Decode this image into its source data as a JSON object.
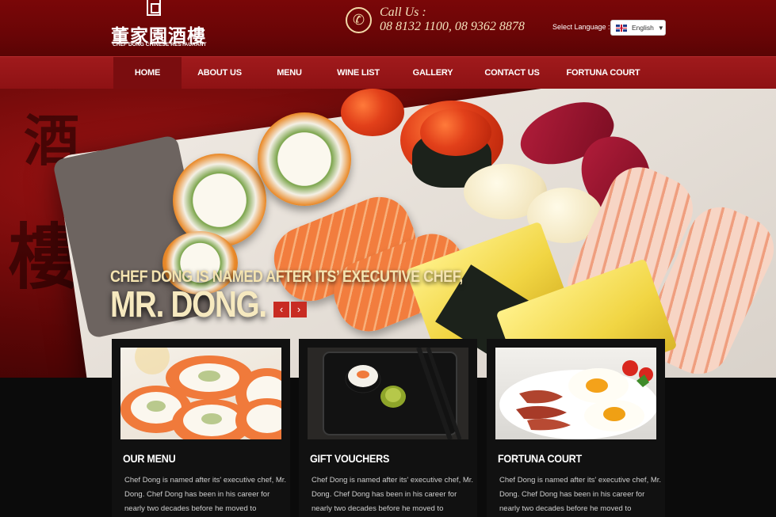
{
  "header": {
    "logo_chinese": "董家園酒樓",
    "logo_english": "CHEF DONG CHINESE RESTAURANT",
    "call_label": "Call Us :",
    "phone_numbers": "08 8132 1100, 08 9362 8878",
    "language_label": "Select Language :",
    "language_selected": "English"
  },
  "nav": {
    "items": [
      {
        "label": "HOME",
        "active": true
      },
      {
        "label": "ABOUT US"
      },
      {
        "label": "MENU"
      },
      {
        "label": "WINE LIST"
      },
      {
        "label": "GALLERY"
      },
      {
        "label": "CONTACT US"
      },
      {
        "label": "FORTUNA COURT"
      }
    ]
  },
  "hero": {
    "line1": "CHEF DONG IS NAMED AFTER ITS’ EXECUTIVE CHEF,",
    "line2": "MR. DONG.",
    "prev_label": "‹",
    "next_label": "›"
  },
  "cards": [
    {
      "title": "OUR MENU",
      "text": "Chef Dong is named after its' executive chef, Mr. Dong. Chef Dong has been in his career for nearly two decades before he moved to Australia"
    },
    {
      "title": "GIFT VOUCHERS",
      "text": "Chef Dong is named after its' executive chef, Mr. Dong. Chef Dong has been in his career for nearly two decades before he moved to Australia"
    },
    {
      "title": "FORTUNA COURT",
      "text": "Chef Dong is named after its' executive chef, Mr. Dong. Chef Dong has been in his career for nearly two decades before he moved to Australia"
    }
  ],
  "colors": {
    "header_red": "#6a0506",
    "nav_red": "#a01a1c",
    "active_nav": "#7a0d0f",
    "hero_text": "#f4e3b0",
    "slider_button": "#c82c23"
  },
  "icons": {
    "phone": "phone-icon",
    "flag": "uk-flag-icon",
    "dropdown": "chevron-down-icon"
  }
}
